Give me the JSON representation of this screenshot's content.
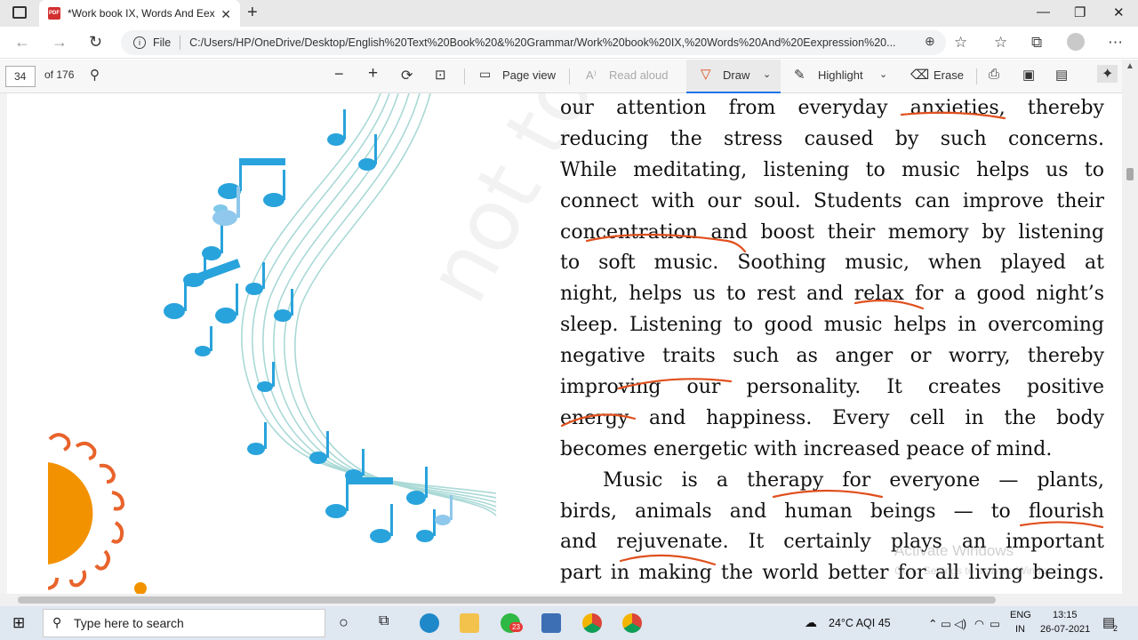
{
  "browser": {
    "tab_title": "*Work book IX, Words And Eexpr",
    "tab_close": "✕",
    "new_tab": "+",
    "file_label": "File",
    "url": "C:/Users/HP/OneDrive/Desktop/English%20Text%20Book%20&%20Grammar/Work%20book%20IX,%20Words%20And%20Eexpression%20...",
    "window_controls": [
      "—",
      "❐",
      "✕"
    ]
  },
  "pdf_toolbar": {
    "page_number": "34",
    "page_total": "of 176",
    "page_view": "Page view",
    "read_aloud": "Read aloud",
    "draw": "Draw",
    "highlight": "Highlight",
    "erase": "Erase"
  },
  "document": {
    "lines": [
      "our attention from everyday anxieties, thereby",
      "reducing the stress caused by such concerns.",
      "While meditating, listening to music helps us to",
      "connect with our soul. Students can improve their",
      "concentration and boost their memory by listening",
      "to soft music. Soothing music, when played at",
      "night, helps us to rest and relax for a good night’s",
      "sleep. Listening to good music helps in overcoming",
      "negative traits such as anger or worry, thereby",
      "improving our personality. It creates positive",
      "energy and happiness. Every cell in the body",
      "becomes energetic with increased peace of mind.",
      "Music is a therapy for everyone — plants,",
      "birds, animals and human beings — to flourish",
      "and rejuvenate. It certainly plays an important",
      "part in making the world better for all living beings."
    ],
    "watermark": "not to be re",
    "activate_title": "Activate Windows",
    "activate_sub": "Go to Settings to activate Windows."
  },
  "taskbar": {
    "search_placeholder": "Type here to search",
    "whatsapp_badge": "23",
    "weather": "24°C  AQI 45",
    "language": "ENG",
    "region": "IN",
    "time": "13:15",
    "date": "26-07-2021",
    "notifications": "2"
  },
  "colors": {
    "annotation_ink": "#e0501e",
    "music_blue": "#29a3dc",
    "sun_orange": "#f39200"
  }
}
